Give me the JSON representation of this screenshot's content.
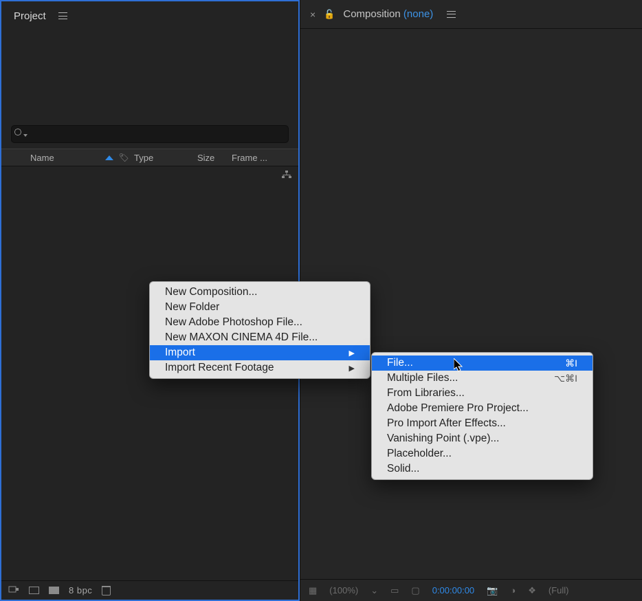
{
  "project_panel": {
    "tab_label": "Project",
    "search_placeholder": "",
    "columns": {
      "name": "Name",
      "type": "Type",
      "size": "Size",
      "frame": "Frame ..."
    },
    "footer": {
      "bpc": "8 bpc"
    }
  },
  "comp_panel": {
    "title_prefix": "Composition ",
    "title_suffix": "(none)",
    "footer": {
      "zoom": "(100%)",
      "timecode": "0:00:00:00",
      "res": "(Full)"
    }
  },
  "context_menu": {
    "items": [
      {
        "label": "New Composition...",
        "submenu": false,
        "highlight": false
      },
      {
        "label": "New Folder",
        "submenu": false,
        "highlight": false
      },
      {
        "label": "New Adobe Photoshop File...",
        "submenu": false,
        "highlight": false
      },
      {
        "label": "New MAXON CINEMA 4D File...",
        "submenu": false,
        "highlight": false
      },
      {
        "label": "Import",
        "submenu": true,
        "highlight": true
      },
      {
        "label": "Import Recent Footage",
        "submenu": true,
        "highlight": false
      }
    ]
  },
  "import_submenu": {
    "items": [
      {
        "label": "File...",
        "shortcut": "⌘I",
        "highlight": true
      },
      {
        "label": "Multiple Files...",
        "shortcut": "⌥⌘I",
        "highlight": false
      },
      {
        "label": "From Libraries...",
        "shortcut": "",
        "highlight": false
      },
      {
        "label": "Adobe Premiere Pro Project...",
        "shortcut": "",
        "highlight": false
      },
      {
        "label": "Pro Import After Effects...",
        "shortcut": "",
        "highlight": false
      },
      {
        "label": "Vanishing Point (.vpe)...",
        "shortcut": "",
        "highlight": false
      },
      {
        "label": "Placeholder...",
        "shortcut": "",
        "highlight": false
      },
      {
        "label": "Solid...",
        "shortcut": "",
        "highlight": false
      }
    ]
  }
}
